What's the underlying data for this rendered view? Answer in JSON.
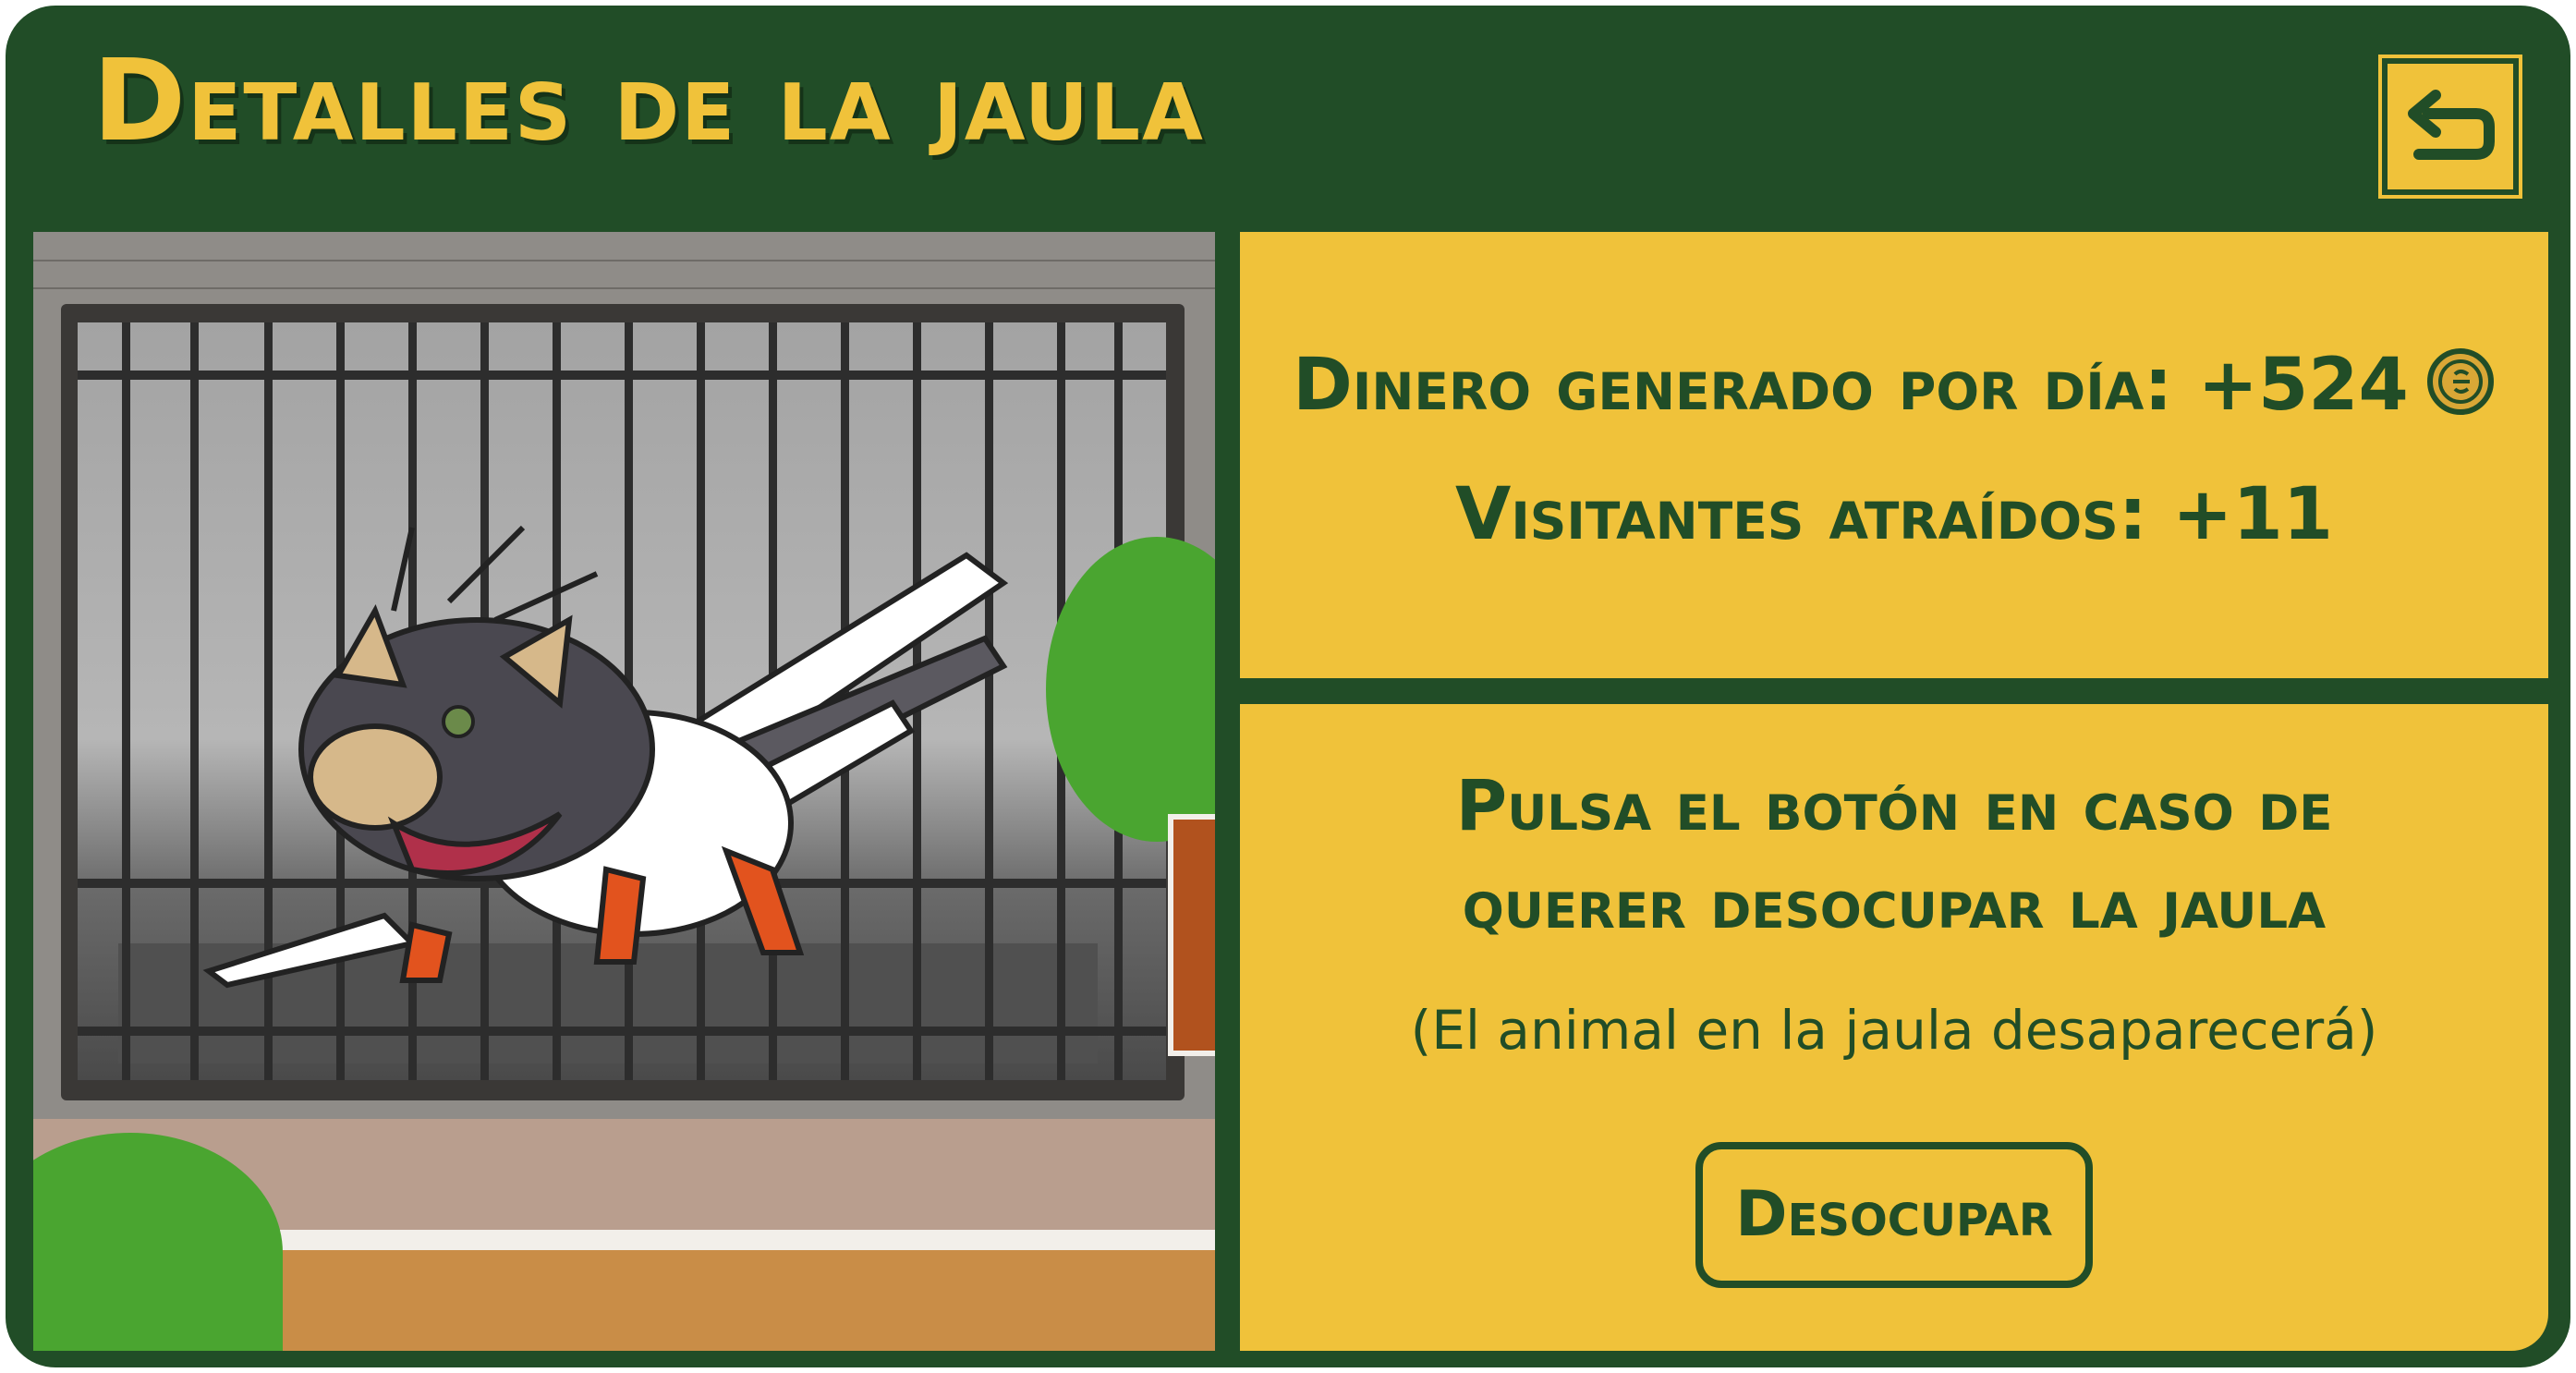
{
  "header": {
    "title": "Detalles de la jaula",
    "back_icon": "return-arrow-icon"
  },
  "stats": {
    "money_label": "Dinero generado por día: +524",
    "money_icon": "coin-icon",
    "visitors_label": "Visitantes atraídos: +11"
  },
  "vacate": {
    "prompt_line1": "Pulsa el botón en caso de",
    "prompt_line2": "querer desocupar la jaula",
    "note": "(El animal en la jaula desaparecerá)",
    "button_label": "Desocupar"
  },
  "colors": {
    "frame_green": "#214d27",
    "panel_yellow": "#f0c23a"
  }
}
